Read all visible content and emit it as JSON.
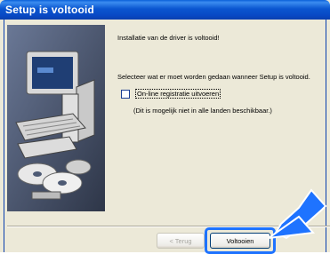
{
  "window": {
    "title": "Setup is voltooid"
  },
  "content": {
    "message": "Installatie van de driver is voltooid!",
    "prompt": "Selecteer wat er moet worden gedaan wanneer Setup is voltooid.",
    "checkbox_label": "On-line registratie uitvoeren",
    "checkbox_checked": false,
    "note": "(Dit is mogelijk niet in alle landen beschikbaar.)"
  },
  "buttons": {
    "back_label": "< Terug",
    "finish_label": "Voltooien"
  },
  "colors": {
    "title_bar": "#0a56d0",
    "highlight": "#1e73ff",
    "arrow": "#1e73ff"
  }
}
